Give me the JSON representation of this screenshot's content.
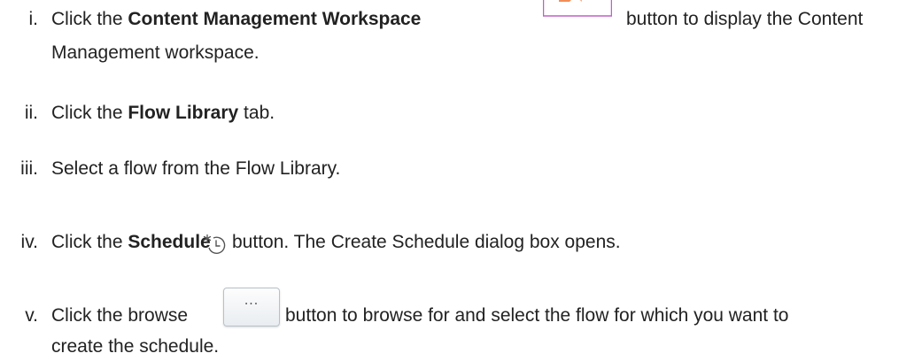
{
  "steps": [
    {
      "num": "i.",
      "pre": "Click the ",
      "bold": "Content Management Workspace",
      "post": "button to display the Content",
      "line2": "Management workspace."
    },
    {
      "num": "ii.",
      "pre": "Click the ",
      "bold": "Flow Library",
      "post": " tab."
    },
    {
      "num": "iii.",
      "text": "Select a flow from the Flow Library."
    },
    {
      "num": "iv.",
      "pre": "Click the ",
      "bold": "Schedule",
      "post": "button. The Create Schedule dialog box opens."
    },
    {
      "num": "v.",
      "pre": "Click the browse",
      "post": "button to browse for and select the flow for which you want to",
      "line2": "create the schedule."
    }
  ],
  "icons": {
    "cmw": "content-management-workspace-icon",
    "schedule": "schedule-clock-icon",
    "browse_label": "···"
  },
  "colors": {
    "cmw_border": "#c45cc8",
    "cmw_accent": "#f07a3a",
    "text": "#222222"
  }
}
